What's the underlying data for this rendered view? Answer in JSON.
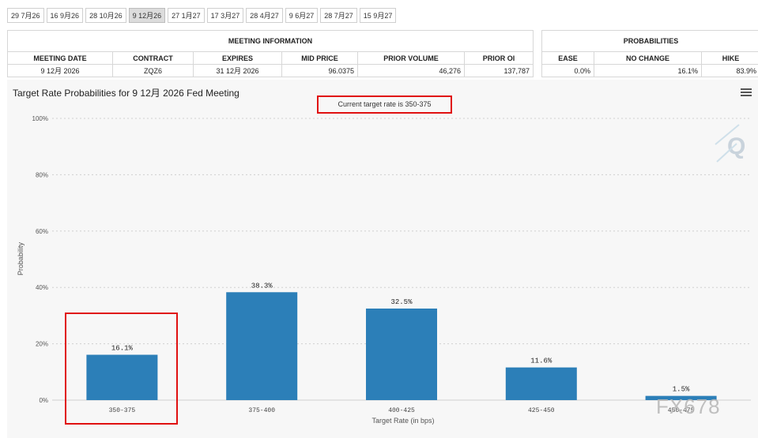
{
  "tabs": [
    "29 7月26",
    "16 9月26",
    "28 10月26",
    "9 12月26",
    "27 1月27",
    "17 3月27",
    "28 4月27",
    "9 6月27",
    "28 7月27",
    "15 9月27"
  ],
  "active_tab": 3,
  "meeting_table": {
    "title": "MEETING INFORMATION",
    "headers": [
      "MEETING DATE",
      "CONTRACT",
      "EXPIRES",
      "MID PRICE",
      "PRIOR VOLUME",
      "PRIOR OI"
    ],
    "row": [
      "9 12月 2026",
      "ZQZ6",
      "31 12月 2026",
      "96.0375",
      "46,276",
      "137,787"
    ]
  },
  "prob_table": {
    "title": "PROBABILITIES",
    "headers": [
      "EASE",
      "NO CHANGE",
      "HIKE"
    ],
    "row": [
      "0.0%",
      "16.1%",
      "83.9%"
    ]
  },
  "chart_title": "Target Rate Probabilities for 9 12月 2026 Fed Meeting",
  "current_rate_note": "Current target rate is 350-375",
  "watermark": "FX678",
  "colors": {
    "bar": "#2c7fb8",
    "highlight": "#e01010",
    "grid": "#d0d0d0"
  },
  "chart_data": {
    "type": "bar",
    "title": "Target Rate Probabilities for 9 12月 2026 Fed Meeting",
    "xlabel": "Target Rate (in bps)",
    "ylabel": "Probability",
    "categories": [
      "350-375",
      "375-400",
      "400-425",
      "425-450",
      "450-475"
    ],
    "values": [
      16.1,
      38.3,
      32.5,
      11.6,
      1.5
    ],
    "data_labels": [
      "16.1%",
      "38.3%",
      "32.5%",
      "11.6%",
      "1.5%"
    ],
    "yticks": [
      "0%",
      "20%",
      "40%",
      "60%",
      "80%",
      "100%"
    ],
    "ylim": [
      0,
      100
    ],
    "grid": true
  }
}
